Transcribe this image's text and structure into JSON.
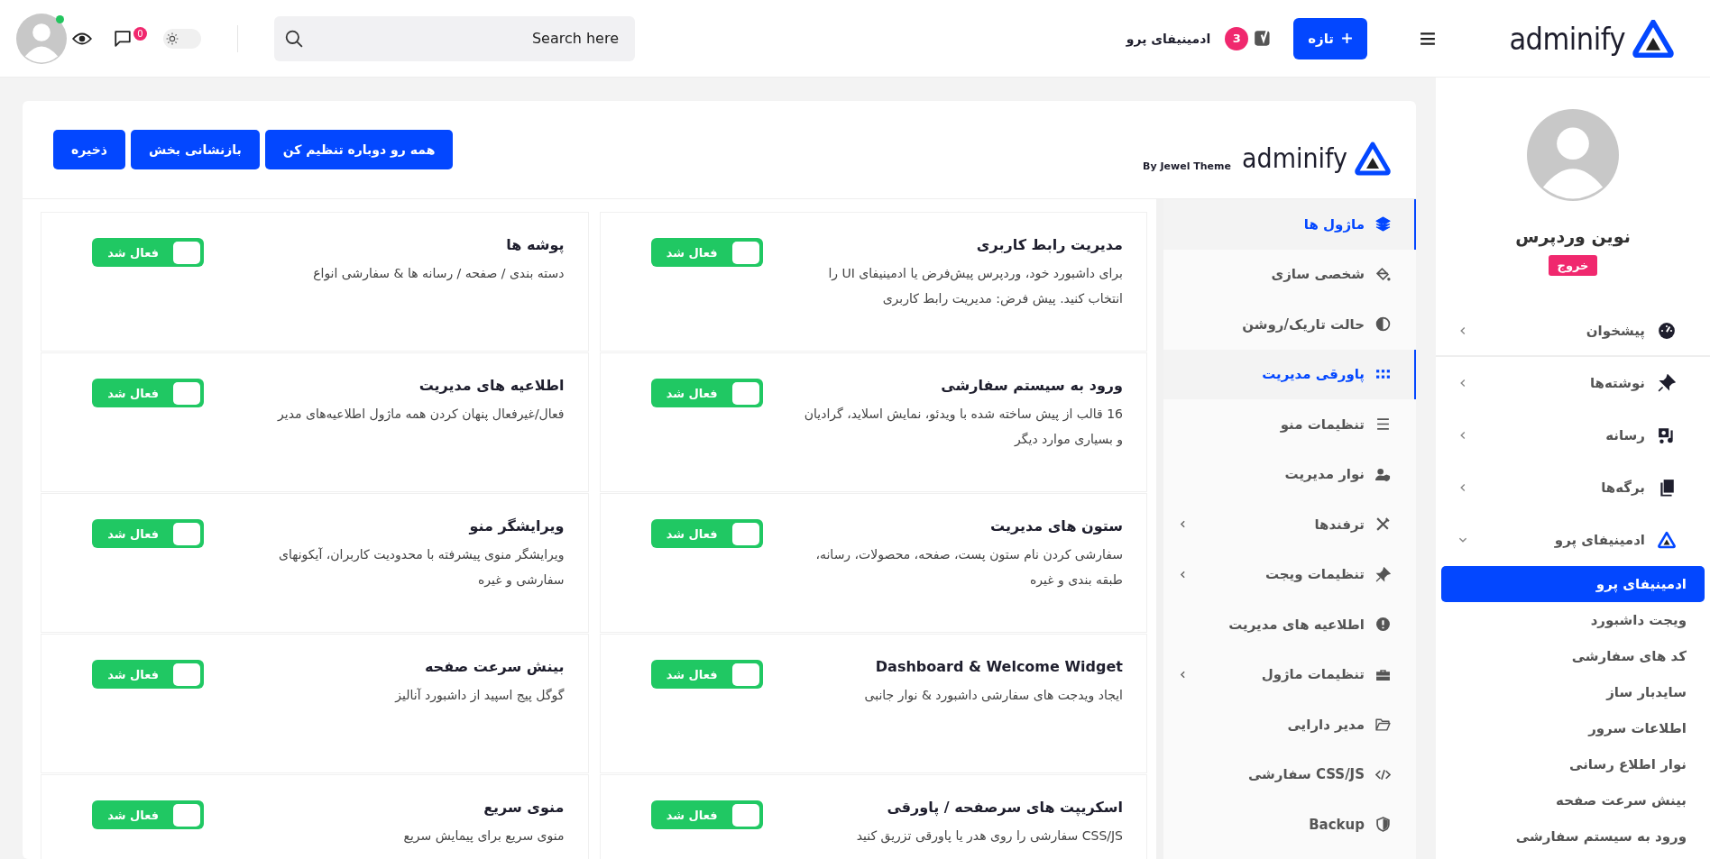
{
  "topbar": {
    "logo": "adminify",
    "new_button": "تازه",
    "notifications_count": "3",
    "site_name": "ادمینیفای پرو",
    "search": {
      "placeholder": "Search here"
    },
    "dark_mode": false,
    "comments_count": "0",
    "online": true
  },
  "sidebar": {
    "user_name": "نوین وردپرس",
    "logout": "خروج",
    "menu": [
      {
        "label": "پیشخوان",
        "expanded": false
      },
      {
        "label": "نوشته‌ها",
        "expanded": false
      },
      {
        "label": "رسانه",
        "expanded": false
      },
      {
        "label": "برگه‌ها",
        "expanded": false
      },
      {
        "label": "ادمینیفای پرو",
        "expanded": true,
        "children": [
          {
            "label": "ادمینیفای پرو",
            "selected": true
          },
          {
            "label": "ویجت داشبورد",
            "selected": false
          },
          {
            "label": "کد های سفارشی",
            "selected": false
          },
          {
            "label": "سایدبار ساز",
            "selected": false
          },
          {
            "label": "اطلاعات سرور",
            "selected": false
          },
          {
            "label": "نوار اطلاع رسانی",
            "selected": false
          },
          {
            "label": "بینش سرعت صفحه",
            "selected": false
          },
          {
            "label": "ورود به سیستم سفارشی",
            "selected": false
          }
        ]
      }
    ]
  },
  "header": {
    "logo": "adminify",
    "byline": "By Jewel Theme",
    "buttons": [
      "همه رو دوباره تنظیم کن",
      "بازنشانی بخش",
      "ذخیره"
    ]
  },
  "nav": [
    {
      "label": "ماژول ها",
      "selected": true,
      "expandable": false
    },
    {
      "label": "شخصی سازی",
      "selected": false,
      "expandable": false
    },
    {
      "label": "حالت تاریک/روشن",
      "selected": false,
      "expandable": false
    },
    {
      "label": "پاورقی مدیریت",
      "selected": true,
      "expandable": false
    },
    {
      "label": "تنظیمات منو",
      "selected": false,
      "expandable": false
    },
    {
      "label": "نوار مدیریت",
      "selected": false,
      "expandable": false
    },
    {
      "label": "ترفندها",
      "selected": false,
      "expandable": true
    },
    {
      "label": "تنظیمات ویجت",
      "selected": false,
      "expandable": true
    },
    {
      "label": "اطلاعیه های مدیریت",
      "selected": false,
      "expandable": false
    },
    {
      "label": "تنظیمات ماژول",
      "selected": false,
      "expandable": true
    },
    {
      "label": "مدیر دارایی",
      "selected": false,
      "expandable": false
    },
    {
      "label": "CSS/JS سفارشی",
      "selected": false,
      "expandable": false
    },
    {
      "label": "Backup",
      "selected": false,
      "expandable": false
    }
  ],
  "modules": [
    {
      "title": "مدیریت رابط کاربری",
      "description": "برای داشبورد خود، وردپرس پیش‌فرض یا ادمینیفای UI را انتخاب کنید. پیش فرض: مدیریت رابط کاربری",
      "toggle": {
        "label": "فعال شد",
        "checked": true
      }
    },
    {
      "title": "پوشه ها",
      "description": "دسته بندی / صفحه / رسانه ها & سفارشی انواع",
      "toggle": {
        "label": "فعال شد",
        "checked": true
      }
    },
    {
      "title": "ورود به سیستم سفارشی",
      "description": "16 قالب از پیش ساخته شده با ویدئو، نمایش اسلاید، گرادیان و بسیاری موارد دیگر",
      "toggle": {
        "label": "فعال شد",
        "checked": true
      }
    },
    {
      "title": "اطلاعیه های مدیریت",
      "description": "فعال/غیرفعال پنهان کردن همه ماژول اطلاعیه‌های مدیر",
      "toggle": {
        "label": "فعال شد",
        "checked": true
      }
    },
    {
      "title": "ستون های مدیریت",
      "description": "سفارشی کردن نام ستون پست، صفحه، محصولات، رسانه، طبقه بندی و غیره",
      "toggle": {
        "label": "فعال شد",
        "checked": true
      }
    },
    {
      "title": "ویرایشگر منو",
      "description": "ویرایشگر منوی پیشرفته با محدودیت کاربران، آیکونهای سفارشی و غیره",
      "toggle": {
        "label": "فعال شد",
        "checked": true
      }
    },
    {
      "title": "Dashboard & Welcome Widget",
      "description": "ایجاد ویدجت های سفارشی داشبورد & نوار جانبی",
      "toggle": {
        "label": "فعال شد",
        "checked": true
      }
    },
    {
      "title": "بینش سرعت صفحه",
      "description": "گوگل پیج اسپید از داشبورد آنالیز",
      "toggle": {
        "label": "فعال شد",
        "checked": true
      }
    },
    {
      "title": "اسکریپت های سرصفحه / پاورقی",
      "description": "CSS/JS سفارشی را روی هدر یا پاورقی تزریق کنید",
      "toggle": {
        "label": "فعال شد",
        "checked": true
      }
    },
    {
      "title": "منوی سریع",
      "description": "منوی سریع برای پیمایش سریع",
      "toggle": {
        "label": "فعال شد",
        "checked": true
      }
    }
  ]
}
